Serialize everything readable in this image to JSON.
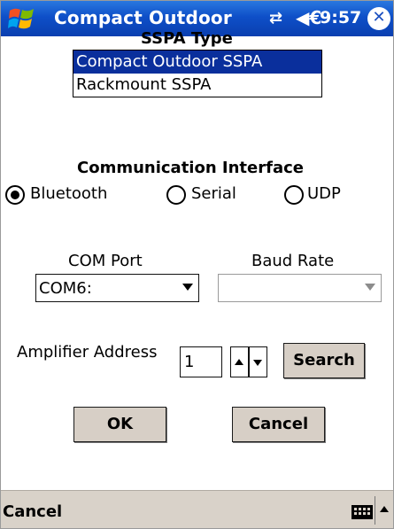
{
  "window": {
    "title": "Compact Outdoor",
    "clock": "9:57",
    "signal_icon": "connectivity-icon",
    "volume_icon": "speaker-icon",
    "close_icon": "close-icon",
    "close_glyph": "✕",
    "start_icon": "windows-flag-icon",
    "signal_glyph": "⇄",
    "volume_glyph": "◀€"
  },
  "ssp_type": {
    "heading": "SSPA Type",
    "options": [
      "Compact Outdoor SSPA",
      "Rackmount SSPA"
    ],
    "selected_index": 0,
    "selected_color": "#0a2f9c"
  },
  "comm": {
    "heading": "Communication Interface",
    "options": [
      "Bluetooth",
      "Serial",
      "UDP"
    ],
    "selected": "Bluetooth"
  },
  "com_port": {
    "label": "COM Port",
    "value": "COM6:"
  },
  "baud_rate": {
    "label": "Baud Rate",
    "value": ""
  },
  "amplifier": {
    "label": "Amplifier Address",
    "value": "1",
    "search_label": "Search"
  },
  "buttons": {
    "ok": "OK",
    "cancel": "Cancel"
  },
  "menubar": {
    "cancel": "Cancel",
    "keyboard_icon": "keyboard-icon"
  },
  "colors": {
    "titlebar": "#0e4fc8",
    "button_bg": "#d7cfc6",
    "menubar_bg": "#d9d2c9"
  }
}
